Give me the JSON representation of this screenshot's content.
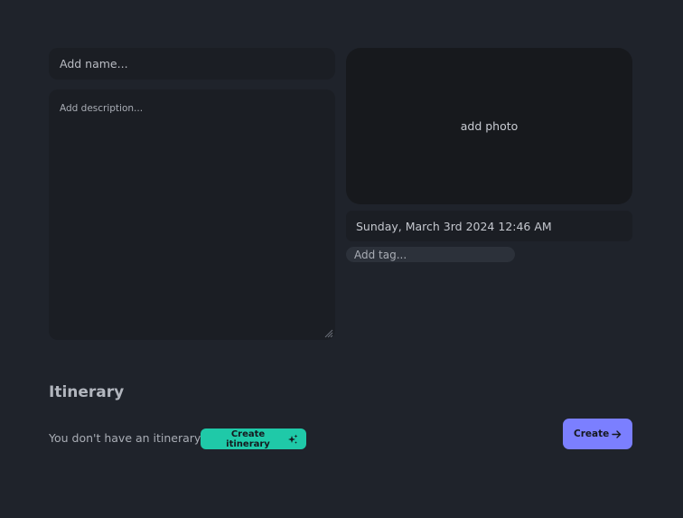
{
  "form": {
    "name_placeholder": "Add name...",
    "name_value": "",
    "description_placeholder": "Add description...",
    "description_value": "",
    "photo_label": "add photo",
    "date_text": "Sunday, March 3rd 2024 12:46 AM",
    "tag_placeholder": "Add tag...",
    "tag_value": ""
  },
  "itinerary": {
    "title": "Itinerary",
    "empty_message": "You don't have an itinerary yet.",
    "create_itinerary_label": "Create itinerary",
    "create_itinerary_icon": "sparkles-icon"
  },
  "actions": {
    "create_label": "Create",
    "create_icon": "arrow-right-icon"
  },
  "colors": {
    "background": "#1f232b",
    "field": "#1b1e24",
    "photo_box": "#17191d",
    "tag_field": "#2c313a",
    "accent_teal": "#1fc9a8",
    "accent_purple": "#7b7fff"
  }
}
